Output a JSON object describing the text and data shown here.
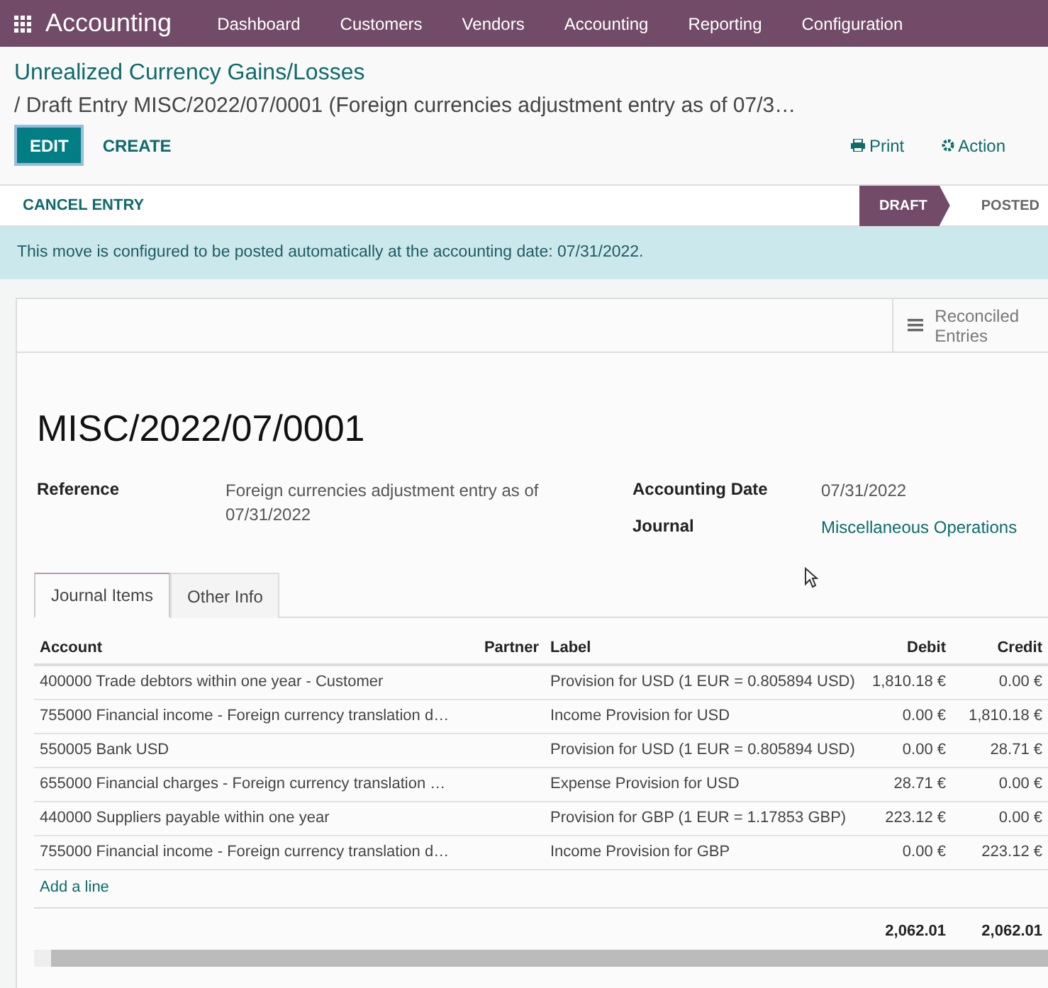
{
  "navbar": {
    "app_title": "Accounting",
    "items": [
      "Dashboard",
      "Customers",
      "Vendors",
      "Accounting",
      "Reporting",
      "Configuration"
    ]
  },
  "breadcrumb": {
    "parent": "Unrealized Currency Gains/Losses",
    "current": "/ Draft Entry MISC/2022/07/0001 (Foreign currencies adjustment entry as of 07/3…"
  },
  "buttons": [
    {
      "label": "EDIT",
      "kind": "primary"
    },
    {
      "label": "CREATE",
      "kind": "secondary"
    }
  ],
  "actions": [
    {
      "label": "Print",
      "kind": "print"
    },
    {
      "label": "Action",
      "kind": "gear"
    }
  ],
  "header": {
    "button": "CANCEL ENTRY",
    "stages": [
      {
        "label": "DRAFT",
        "selected": true
      },
      {
        "label": "POSTED",
        "selected": false
      }
    ]
  },
  "alert": "This move is configured to be posted automatically at the accounting date: 07/31/2022.",
  "smart_button": "Reconciled Entries",
  "record_title": "MISC/2022/07/0001",
  "left_fields": [
    {
      "label": "Reference",
      "value": "Foreign currencies adjustment entry as of 07/31/2022",
      "kind": "text"
    }
  ],
  "right_fields": [
    {
      "label": "Accounting Date",
      "value": "07/31/2022",
      "kind": "text"
    },
    {
      "label": "Journal",
      "value": "Miscellaneous Operations",
      "kind": "link"
    }
  ],
  "tabs": [
    {
      "label": "Journal Items",
      "selected": true
    },
    {
      "label": "Other Info",
      "selected": false
    }
  ],
  "table": {
    "columns": [
      "Account",
      "Partner",
      "Label",
      "Debit",
      "Credit"
    ],
    "rows": [
      {
        "account": "400000 Trade debtors within one year - Customer",
        "partner": "",
        "label": "Provision for USD (1 EUR = 0.805894 USD)",
        "debit": "1,810.18 €",
        "credit": "0.00 €"
      },
      {
        "account": "755000 Financial income - Foreign currency translation d…",
        "partner": "",
        "label": "Income Provision for USD",
        "debit": "0.00 €",
        "credit": "1,810.18 €"
      },
      {
        "account": "550005 Bank USD",
        "partner": "",
        "label": "Provision for USD (1 EUR = 0.805894 USD)",
        "debit": "0.00 €",
        "credit": "28.71 €"
      },
      {
        "account": "655000 Financial charges - Foreign currency translation …",
        "partner": "",
        "label": "Expense Provision for USD",
        "debit": "28.71 €",
        "credit": "0.00 €"
      },
      {
        "account": "440000 Suppliers payable within one year",
        "partner": "",
        "label": "Provision for GBP (1 EUR = 1.17853 GBP)",
        "debit": "223.12 €",
        "credit": "0.00 €"
      },
      {
        "account": "755000 Financial income - Foreign currency translation d…",
        "partner": "",
        "label": "Income Provision for GBP",
        "debit": "0.00 €",
        "credit": "223.12 €"
      }
    ],
    "add_line": "Add a line",
    "totals": {
      "debit": "2,062.01",
      "credit": "2,062.01"
    }
  }
}
